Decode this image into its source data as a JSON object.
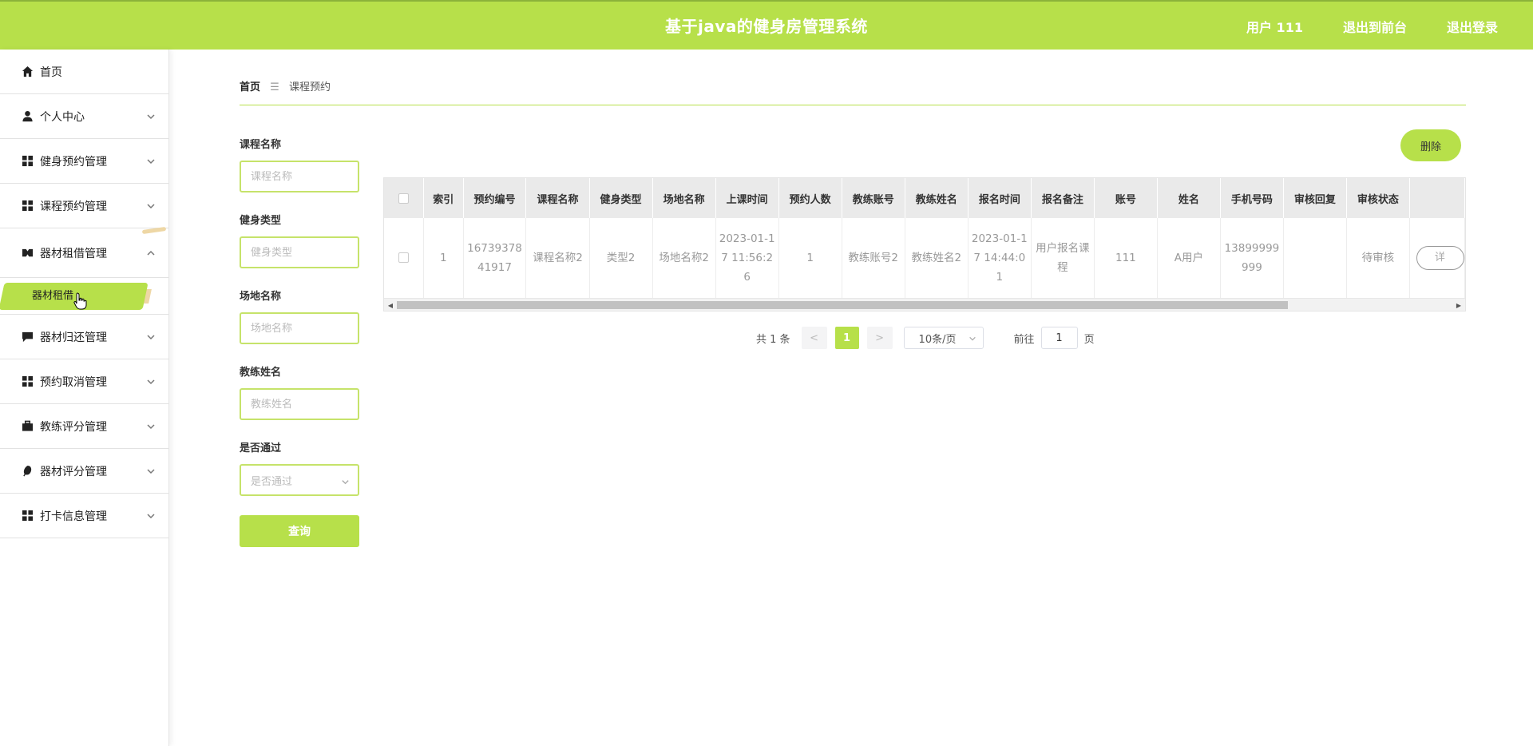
{
  "header": {
    "title": "基于java的健身房管理系统",
    "user_label": "用户 111",
    "front_label": "退出到前台",
    "logout_label": "退出登录"
  },
  "sidebar": {
    "items": [
      {
        "label": "首页",
        "icon": "home-icon"
      },
      {
        "label": "个人中心",
        "icon": "user-icon"
      },
      {
        "label": "健身预约管理",
        "icon": "grid-icon"
      },
      {
        "label": "课程预约管理",
        "icon": "grid-icon"
      },
      {
        "label": "器材租借管理",
        "icon": "equipment-icon",
        "expanded": true
      },
      {
        "label": "器材归还管理",
        "icon": "chat-icon"
      },
      {
        "label": "预约取消管理",
        "icon": "grid-icon"
      },
      {
        "label": "教练评分管理",
        "icon": "briefcase-icon"
      },
      {
        "label": "器材评分管理",
        "icon": "leaf-icon"
      },
      {
        "label": "打卡信息管理",
        "icon": "grid-icon"
      }
    ],
    "submenu": {
      "label": "器材租借"
    }
  },
  "breadcrumb": {
    "home": "首页",
    "separator": "☰",
    "current": "课程预约"
  },
  "search": {
    "course_name_label": "课程名称",
    "course_name_placeholder": "课程名称",
    "fitness_type_label": "健身类型",
    "fitness_type_placeholder": "健身类型",
    "venue_label": "场地名称",
    "venue_placeholder": "场地名称",
    "coach_label": "教练姓名",
    "coach_placeholder": "教练姓名",
    "passed_label": "是否通过",
    "passed_placeholder": "是否通过",
    "query_label": "查询"
  },
  "actions": {
    "delete_label": "删除"
  },
  "table": {
    "headers": [
      "索引",
      "预约编号",
      "课程名称",
      "健身类型",
      "场地名称",
      "上课时间",
      "预约人数",
      "教练账号",
      "教练姓名",
      "报名时间",
      "报名备注",
      "账号",
      "姓名",
      "手机号码",
      "审核回复",
      "审核状态"
    ],
    "rows": [
      [
        "1",
        "1673937841917",
        "课程名称2",
        "类型2",
        "场地名称2",
        "2023-01-17 11:56:26",
        "1",
        "教练账号2",
        "教练姓名2",
        "2023-01-17 14:44:01",
        "用户报名课程",
        "111",
        "A用户",
        "13899999999",
        "",
        "待审核"
      ]
    ],
    "detail_label": "详"
  },
  "pagination": {
    "total": "共 1 条",
    "prev": "<",
    "current": "1",
    "next": ">",
    "page_size": "10条/页",
    "goto_label": "前往",
    "goto_value": "1",
    "page_unit": "页"
  },
  "colors": {
    "accent": "#b7e04a",
    "header_border": "#8bb23a"
  }
}
